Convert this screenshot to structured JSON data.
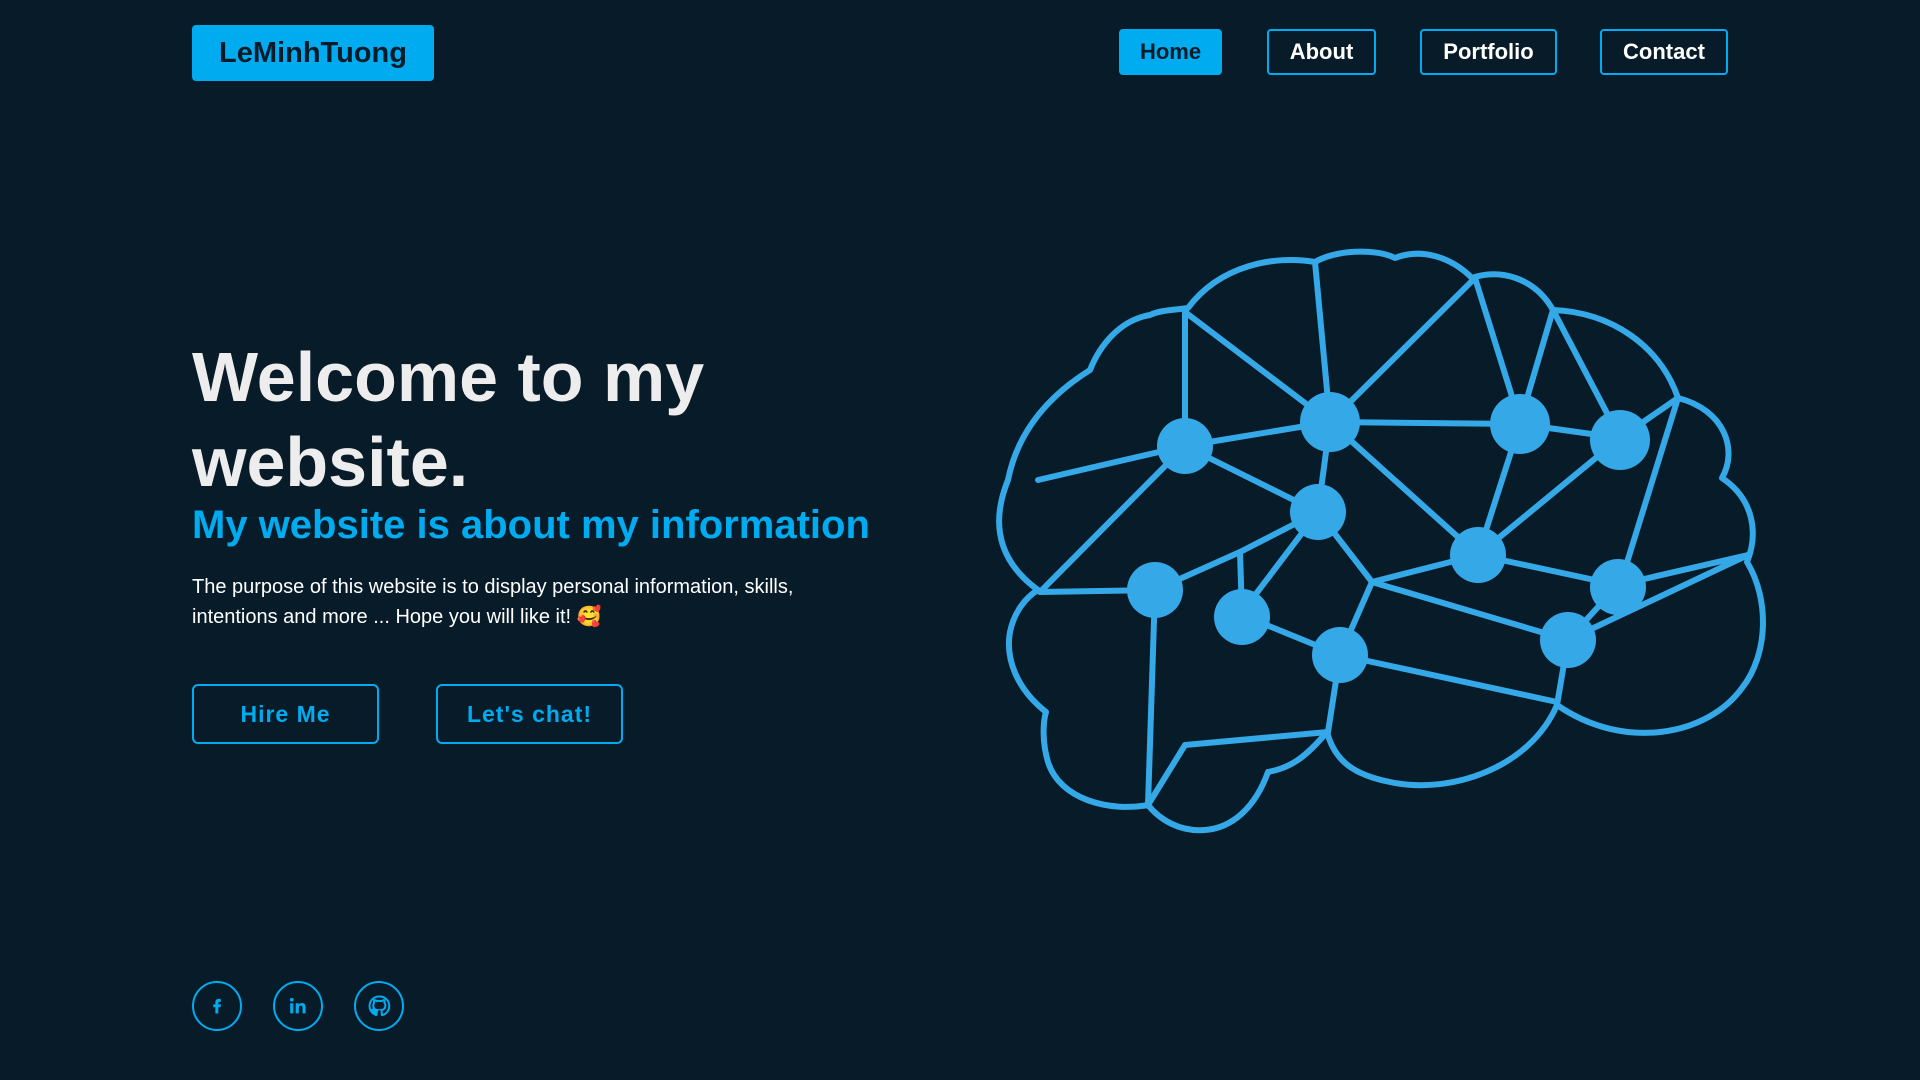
{
  "header": {
    "logo": "LeMinhTuong",
    "nav": {
      "home": "Home",
      "about": "About",
      "portfolio": "Portfolio",
      "contact": "Contact"
    }
  },
  "hero": {
    "title": "Welcome to my website.",
    "subtitle": "My website is about my information",
    "description": "The purpose of this website is to display personal information, skills, intentions and more ... Hope you will like it! 🥰",
    "buttons": {
      "hire": "Hire Me",
      "chat": "Let's chat!"
    }
  },
  "social": {
    "facebook": "facebook-icon",
    "linkedin": "linkedin-icon",
    "github": "github-icon"
  },
  "illustration": {
    "name": "brain-network-icon"
  },
  "colors": {
    "background": "#081b29",
    "accent": "#00abf0",
    "brain": "#35a8e8",
    "text": "#ededed"
  }
}
